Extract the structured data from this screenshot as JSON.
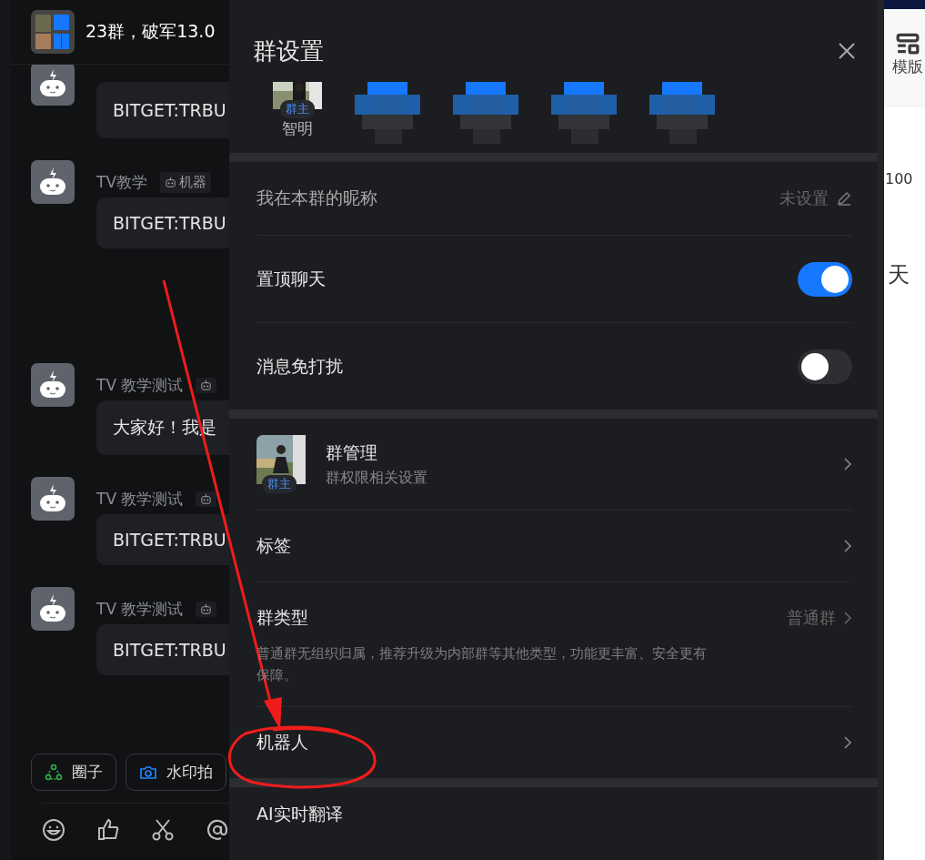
{
  "chat": {
    "title": "23群，破军13.0",
    "messages": [
      {
        "text": "BITGET:TRBU"
      },
      {
        "sender": "TV教学",
        "tag": "机器",
        "text": "BITGET:TRBU"
      },
      {
        "sender": "TV 教学测试",
        "text": "大家好！我是"
      },
      {
        "sender": "TV 教学测试",
        "text": "BITGET:TRBU"
      },
      {
        "sender": "TV 教学测试",
        "text": "BITGET:TRBU"
      }
    ],
    "chips": [
      {
        "label": "圈子",
        "kind": "circle"
      },
      {
        "label": "水印拍",
        "kind": "camera"
      }
    ]
  },
  "settings": {
    "title": "群设置",
    "members": [
      {
        "kind": "owner",
        "badge": "群主",
        "name": "智明"
      },
      {
        "kind": "blurred"
      },
      {
        "kind": "blurred"
      },
      {
        "kind": "blurred"
      },
      {
        "kind": "blurred"
      }
    ],
    "sections": [
      [
        {
          "kind": "value",
          "label": "我在本群的昵称",
          "value": "未设置"
        },
        {
          "kind": "toggle",
          "label": "置顶聊天",
          "on": true
        },
        {
          "kind": "toggle",
          "label": "消息免打扰",
          "on": false
        }
      ],
      [
        {
          "kind": "manage",
          "label": "群管理",
          "sub": "群权限相关设置",
          "badge": "群主"
        },
        {
          "kind": "link",
          "label": "标签"
        },
        {
          "kind": "type",
          "label": "群类型",
          "value": "普通群",
          "desc": "普通群无组织归属，推荐升级为内部群等其他类型，功能更丰富、安全更有保障。"
        },
        {
          "kind": "link",
          "label": "机器人"
        }
      ],
      [
        {
          "kind": "plain",
          "label": "AI实时翻译"
        }
      ]
    ]
  },
  "side": {
    "tool": "模版",
    "number": "100",
    "day": "天"
  }
}
